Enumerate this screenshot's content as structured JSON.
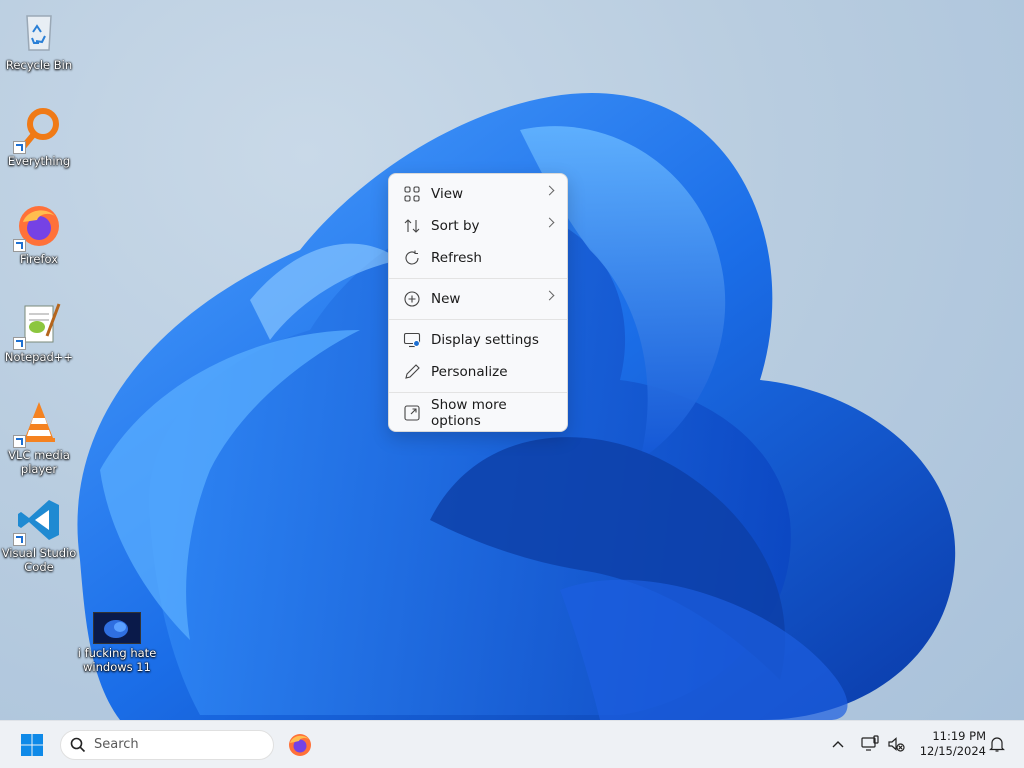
{
  "desktop": {
    "icons": [
      {
        "label": "Recycle Bin",
        "icon": "recycle-bin-icon"
      },
      {
        "label": "Everything",
        "icon": "everything-search-icon"
      },
      {
        "label": "Firefox",
        "icon": "firefox-icon"
      },
      {
        "label": "Notepad++",
        "icon": "notepad-plus-plus-icon"
      },
      {
        "label": "VLC media player",
        "icon": "vlc-icon"
      },
      {
        "label": "Visual Studio Code",
        "icon": "vscode-icon"
      },
      {
        "label": "i fucking hate windows 11",
        "icon": "image-file-icon"
      }
    ]
  },
  "context_menu": {
    "items": [
      {
        "label": "View",
        "icon": "grid-icon",
        "submenu": true
      },
      {
        "label": "Sort by",
        "icon": "sort-icon",
        "submenu": true
      },
      {
        "label": "Refresh",
        "icon": "refresh-icon",
        "submenu": false
      },
      {
        "label": "New",
        "icon": "plus-circle-icon",
        "submenu": true
      },
      {
        "label": "Display settings",
        "icon": "display-icon",
        "submenu": false
      },
      {
        "label": "Personalize",
        "icon": "pen-icon",
        "submenu": false
      },
      {
        "label": "Show more options",
        "icon": "expand-icon",
        "submenu": false
      }
    ]
  },
  "taskbar": {
    "search_placeholder": "Search",
    "clock_time": "11:19 PM",
    "clock_date": "12/15/2024"
  },
  "colors": {
    "accent": "#0078d4",
    "bloom_dark": "#0a3fb8",
    "bloom_light": "#3a8cf5"
  }
}
